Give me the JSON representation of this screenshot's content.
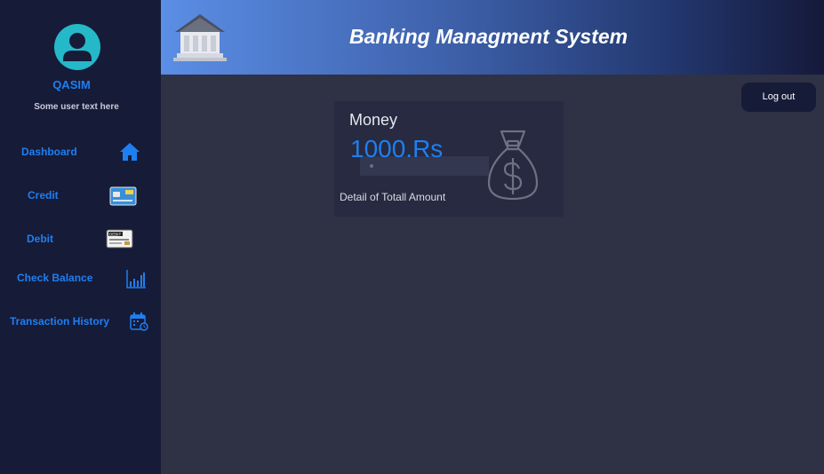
{
  "sidebar": {
    "user_name": "QASIM",
    "user_text": "Some user text here",
    "items": [
      {
        "label": "Dashboard",
        "icon": "home-icon"
      },
      {
        "label": "Credit",
        "icon": "credit-card-icon"
      },
      {
        "label": "Debit",
        "icon": "debit-card-icon"
      },
      {
        "label": "Check Balance",
        "icon": "bar-chart-icon"
      },
      {
        "label": "Transaction History",
        "icon": "calendar-icon"
      }
    ]
  },
  "header": {
    "title": "Banking Managment System",
    "icon": "bank-building-icon"
  },
  "logout_label": "Log out",
  "card": {
    "title": "Money",
    "amount": "1000.Rs",
    "description": "Detail of Totall Amount",
    "icon": "money-bag-icon"
  },
  "colors": {
    "accent": "#1e7ff0",
    "sidebar_bg": "#161b38",
    "main_bg": "#2f3145",
    "card_bg": "#272a40"
  }
}
